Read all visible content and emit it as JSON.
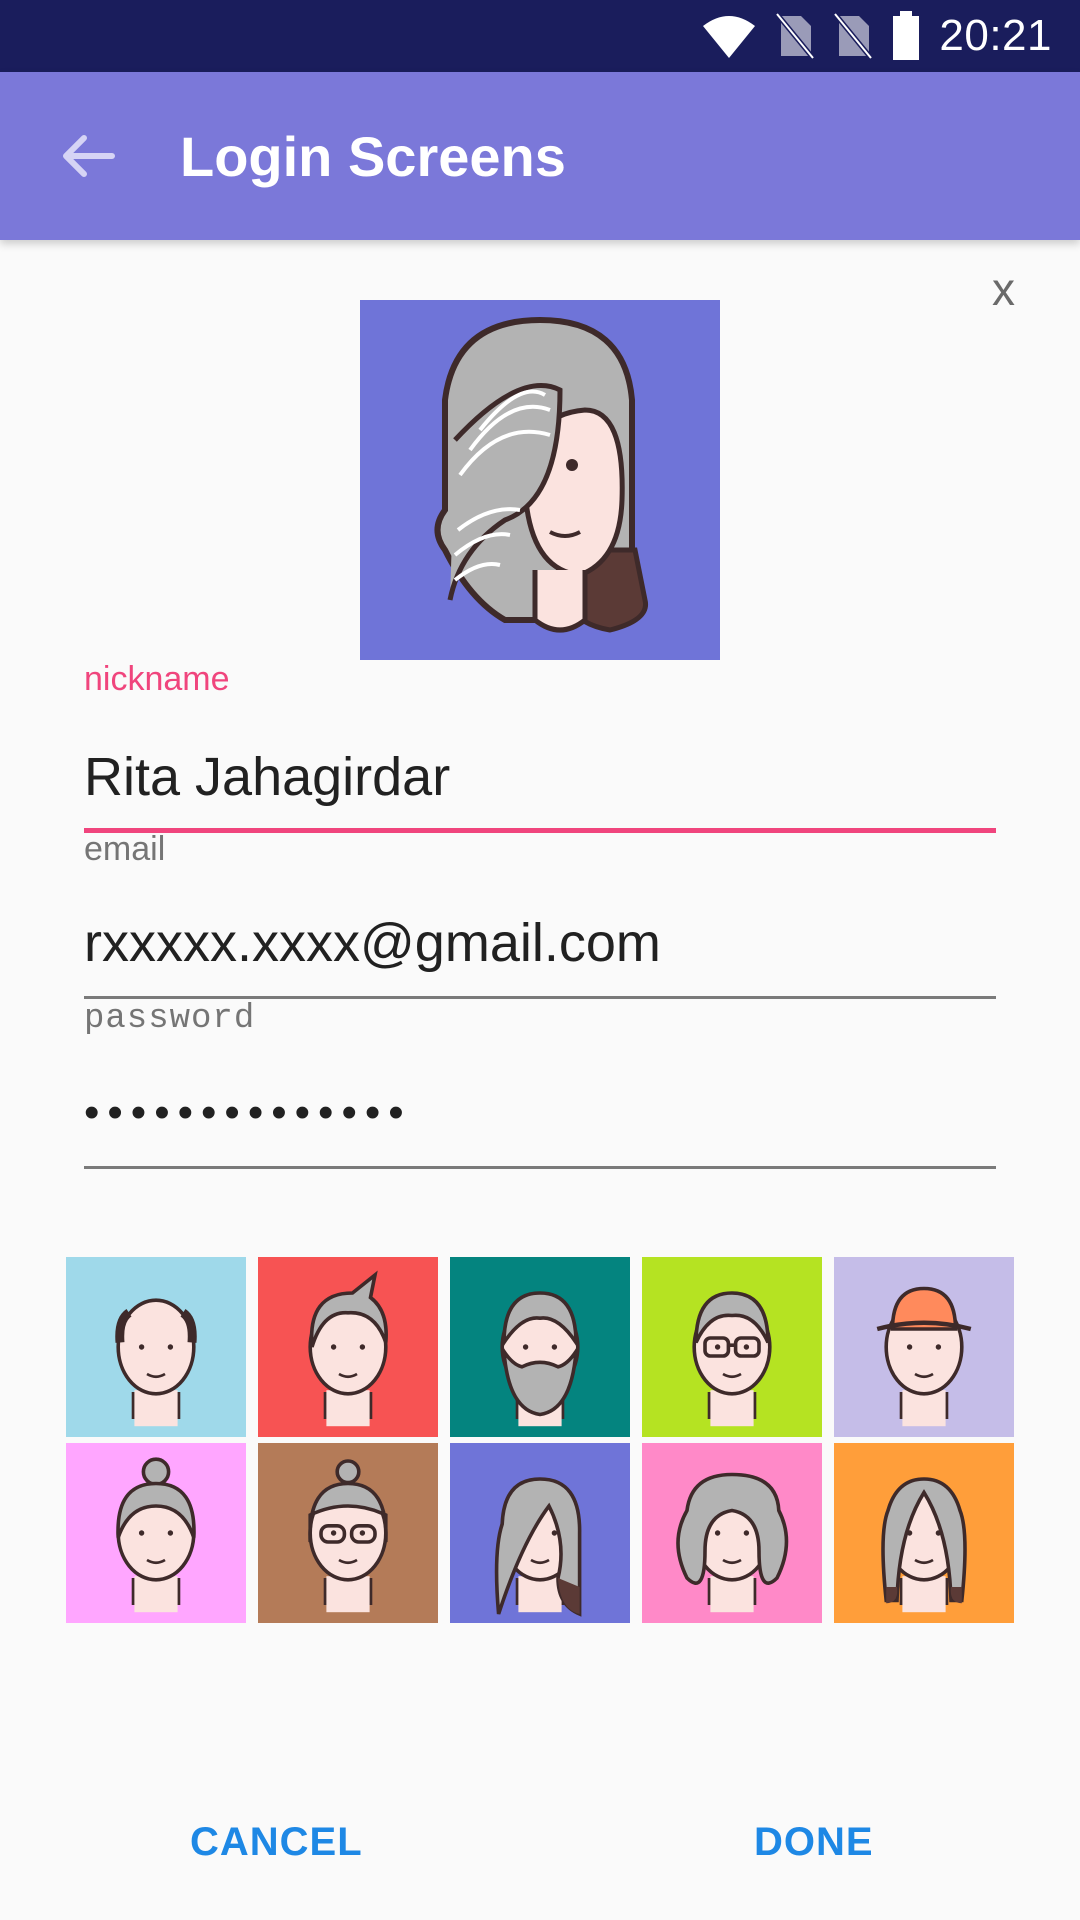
{
  "status_bar": {
    "time": "20:21",
    "icons": [
      "wifi-icon",
      "no-sim-icon",
      "no-sim-icon",
      "battery-icon"
    ]
  },
  "app_bar": {
    "title": "Login Screens",
    "back_icon": "arrow-back-icon"
  },
  "dialog": {
    "close_label": "x",
    "selected_avatar": {
      "bg": "#6f74d8",
      "hair": "#b3b3b3",
      "kind": "long-hair-woman"
    },
    "fields": {
      "nickname": {
        "label": "nickname",
        "value": "Rita Jahagirdar"
      },
      "email": {
        "label": "email",
        "value": "rxxxxx.xxxx@gmail.com"
      },
      "password": {
        "label": "password",
        "value": "••••••••••••••"
      }
    },
    "avatars": [
      {
        "bg": "#9fd9ea",
        "kind": "bald-man"
      },
      {
        "bg": "#f75353",
        "kind": "spiky-hair-man"
      },
      {
        "bg": "#04847f",
        "kind": "bearded-man"
      },
      {
        "bg": "#b5e322",
        "kind": "glasses-man"
      },
      {
        "bg": "#c5bde8",
        "kind": "hat-man"
      },
      {
        "bg": "#ffa6ff",
        "kind": "bun-woman"
      },
      {
        "bg": "#b47b58",
        "kind": "glasses-woman"
      },
      {
        "bg": "#6f74d8",
        "kind": "long-hair-woman"
      },
      {
        "bg": "#ff89c8",
        "kind": "curly-hair-woman"
      },
      {
        "bg": "#ff9e3a",
        "kind": "parted-hair-woman"
      }
    ],
    "actions": {
      "cancel": "CANCEL",
      "done": "DONE"
    },
    "colors": {
      "accent": "#f0457d",
      "button": "#1e88e5",
      "app_bar": "#7b78d9",
      "status_bar": "#1a1d5c"
    }
  }
}
